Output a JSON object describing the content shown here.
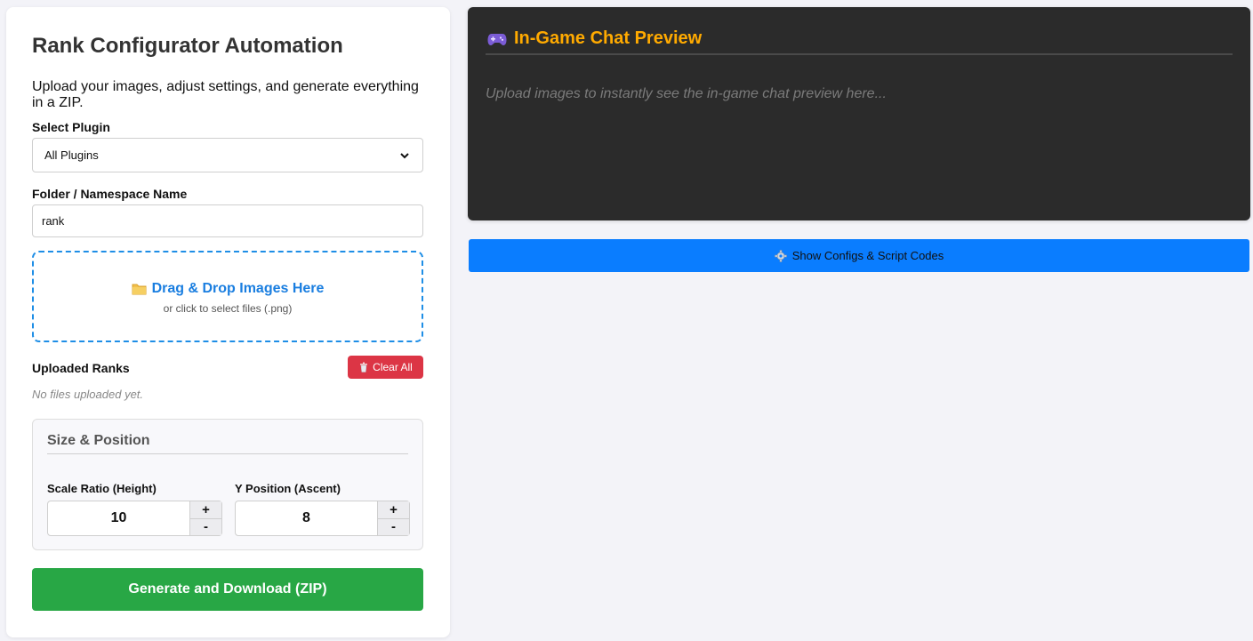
{
  "left": {
    "title": "Rank Configurator Automation",
    "subtitle": "Upload your images, adjust settings, and generate everything in a ZIP.",
    "plugin_label": "Select Plugin",
    "plugin_selected": "All Plugins",
    "namespace_label": "Folder / Namespace Name",
    "namespace_value": "rank",
    "dropzone_main": "Drag & Drop Images Here",
    "dropzone_sub": "or click to select files (.png)",
    "uploaded_label": "Uploaded Ranks",
    "clear_label": "Clear All",
    "no_files": "No files uploaded yet.",
    "size_title": "Size & Position",
    "scale_label": "Scale Ratio (Height)",
    "scale_value": "10",
    "ypos_label": "Y Position (Ascent)",
    "ypos_value": "8",
    "plus": "+",
    "minus": "-",
    "generate_label": "Generate and Download (ZIP)"
  },
  "preview": {
    "title": "In-Game Chat Preview",
    "placeholder": "Upload images to instantly see the in-game chat preview here..."
  },
  "show_configs_label": "Show Configs & Script Codes",
  "icons": {
    "folder": "folder-icon",
    "trash": "trash-icon",
    "gamepad": "gamepad-icon",
    "gear": "gear-icon"
  },
  "colors": {
    "blue_accent": "#1a7ee0",
    "danger": "#dc3545",
    "success": "#28a745",
    "preview_bg": "#2b2b2b",
    "preview_title": "#ffaa00",
    "primary_button": "#0a7dff"
  }
}
